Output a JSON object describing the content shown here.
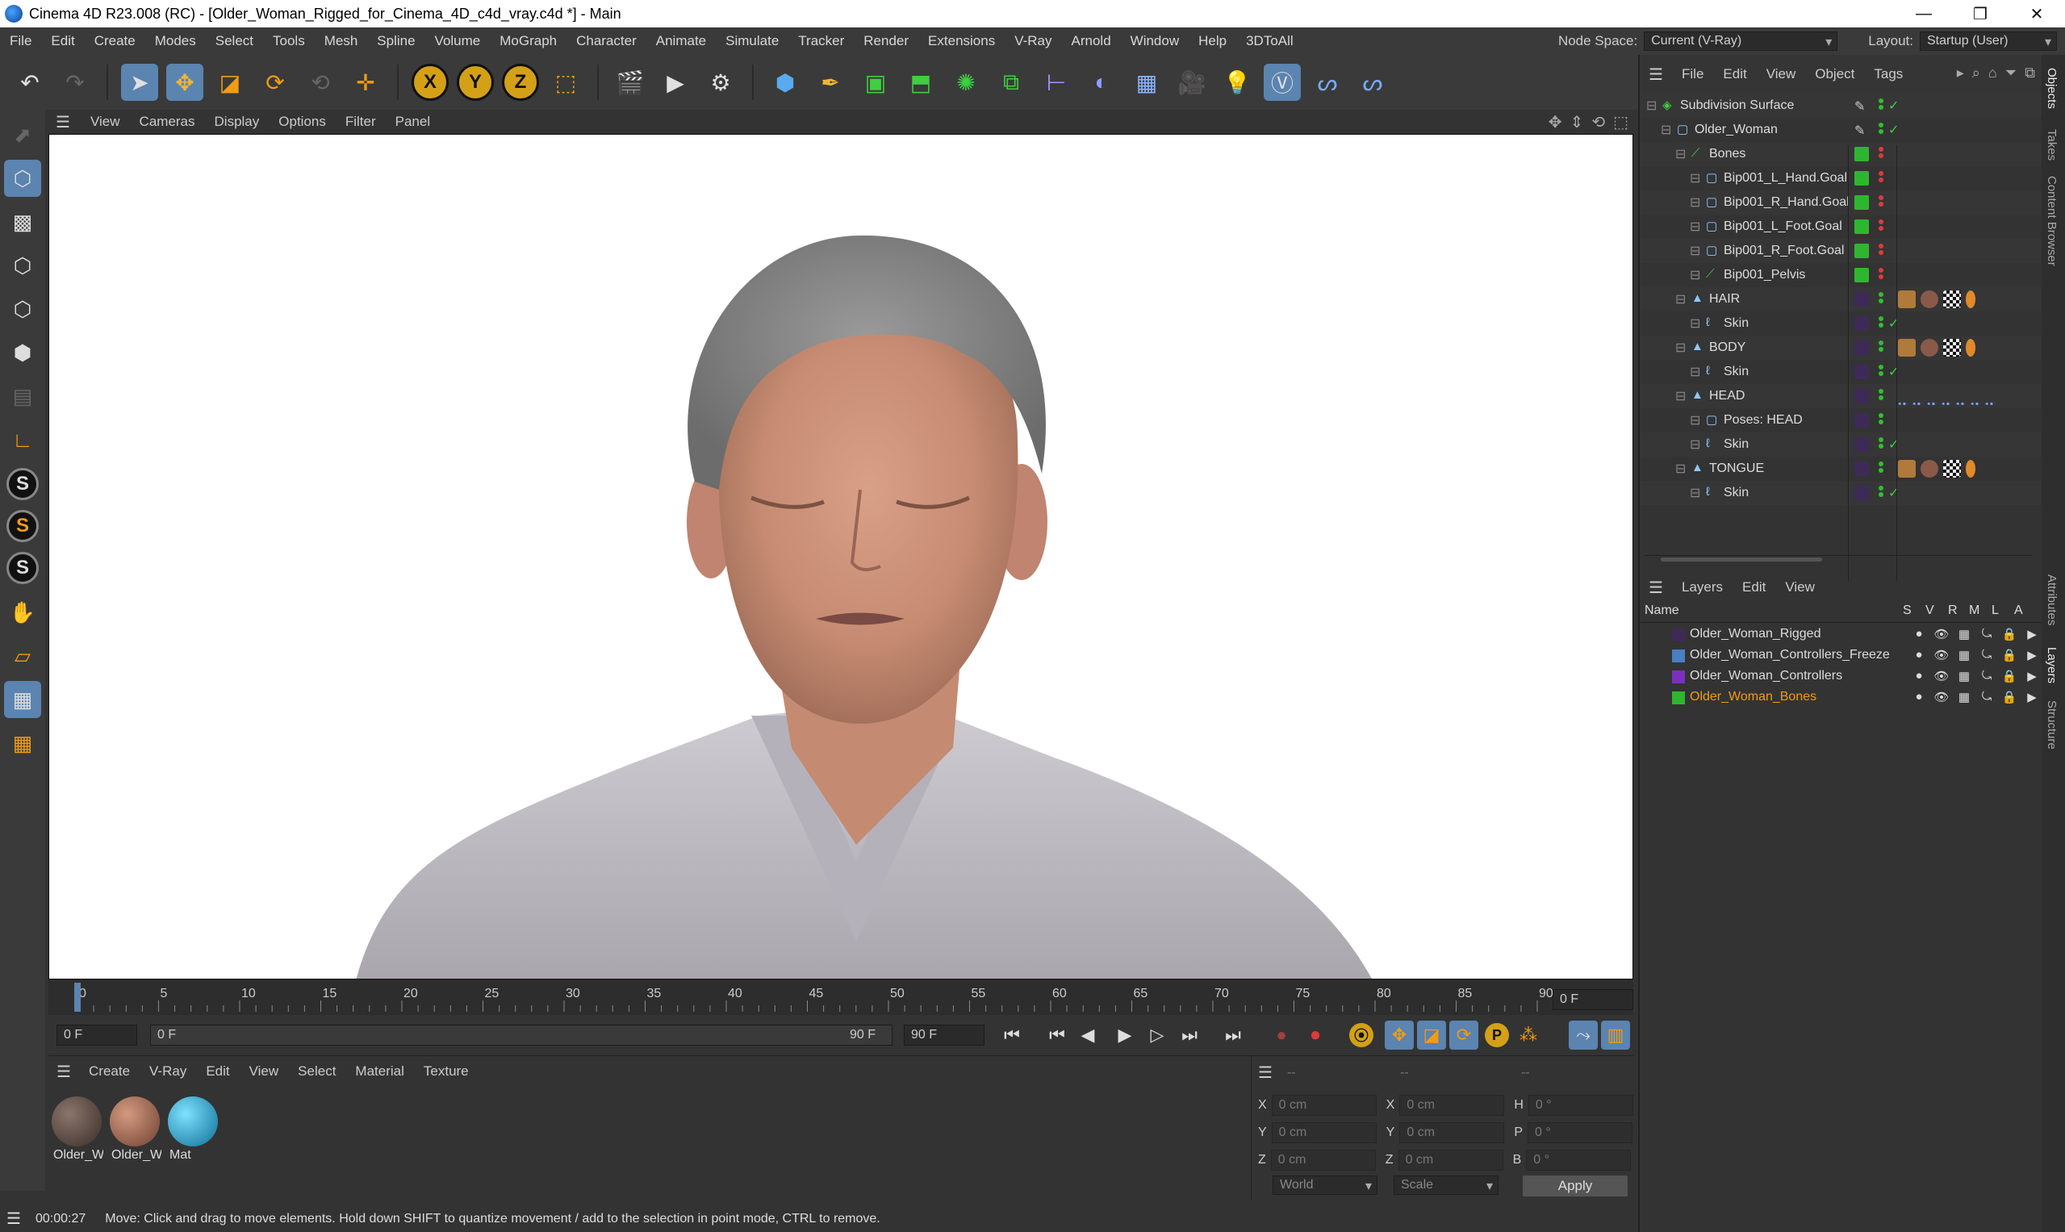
{
  "window": {
    "title": "Cinema 4D R23.008 (RC) - [Older_Woman_Rigged_for_Cinema_4D_c4d_vray.c4d *] - Main",
    "minimize": "—",
    "maximize": "❐",
    "close": "✕"
  },
  "menu": [
    "File",
    "Edit",
    "Create",
    "Modes",
    "Select",
    "Tools",
    "Mesh",
    "Spline",
    "Volume",
    "MoGraph",
    "Character",
    "Animate",
    "Simulate",
    "Tracker",
    "Render",
    "Extensions",
    "V-Ray",
    "Arnold",
    "Window",
    "Help",
    "3DToAll"
  ],
  "menu_right": {
    "node_space_label": "Node Space:",
    "node_space_value": "Current (V-Ray)",
    "layout_label": "Layout:",
    "layout_value": "Startup (User)"
  },
  "viewport_menu": [
    "View",
    "Cameras",
    "Display",
    "Options",
    "Filter",
    "Panel"
  ],
  "timeline": {
    "ticks": [
      "0",
      "5",
      "10",
      "15",
      "20",
      "25",
      "30",
      "35",
      "40",
      "45",
      "50",
      "55",
      "60",
      "65",
      "70",
      "75",
      "80",
      "85",
      "90"
    ],
    "current_frame": "0 F"
  },
  "transport": {
    "start_field": "0 F",
    "range_start": "0 F",
    "range_end": "90 F",
    "end_field": "90 F"
  },
  "material_manager": {
    "menu": [
      "Create",
      "V-Ray",
      "Edit",
      "View",
      "Select",
      "Material",
      "Texture"
    ],
    "materials": [
      {
        "label": "Older_W",
        "color": "#5a4a44"
      },
      {
        "label": "Older_W",
        "color": "#a86e58"
      },
      {
        "label": "Mat",
        "color": "#1ea9d6"
      }
    ]
  },
  "coordinates": {
    "header": [
      "--",
      "--",
      "--"
    ],
    "rows": [
      {
        "a": "X",
        "av": "0 cm",
        "b": "X",
        "bv": "0 cm",
        "c": "H",
        "cv": "0 °"
      },
      {
        "a": "Y",
        "av": "0 cm",
        "b": "Y",
        "bv": "0 cm",
        "c": "P",
        "cv": "0 °"
      },
      {
        "a": "Z",
        "av": "0 cm",
        "b": "Z",
        "bv": "0 cm",
        "c": "B",
        "cv": "0 °"
      }
    ],
    "mode1": "World",
    "mode2": "Scale",
    "apply": "Apply"
  },
  "status": {
    "time": "00:00:27",
    "message": "Move: Click and drag to move elements. Hold down SHIFT to quantize movement / add to the selection in point mode, CTRL to remove."
  },
  "object_manager": {
    "menu": [
      "File",
      "Edit",
      "View",
      "Object",
      "Tags"
    ],
    "objects": [
      {
        "name": "Subdivision Surface",
        "depth": 0,
        "icon": "subdivision-icon",
        "vis": "check"
      },
      {
        "name": "Older_Woman",
        "depth": 1,
        "icon": "null-icon",
        "vis": "check"
      },
      {
        "name": "Bones",
        "depth": 2,
        "icon": "bone-icon",
        "vis": "green"
      },
      {
        "name": "Bip001_L_Hand.Goal",
        "depth": 3,
        "icon": "null-icon",
        "vis": "green"
      },
      {
        "name": "Bip001_R_Hand.Goal",
        "depth": 3,
        "icon": "null-icon",
        "vis": "green"
      },
      {
        "name": "Bip001_L_Foot.Goal",
        "depth": 3,
        "icon": "null-icon",
        "vis": "green"
      },
      {
        "name": "Bip001_R_Foot.Goal",
        "depth": 3,
        "icon": "null-icon",
        "vis": "green"
      },
      {
        "name": "Bip001_Pelvis",
        "depth": 3,
        "icon": "bone-icon",
        "vis": "green"
      },
      {
        "name": "HAIR",
        "depth": 2,
        "icon": "polygon-icon",
        "vis": "purple"
      },
      {
        "name": "Skin",
        "depth": 3,
        "icon": "skin-icon",
        "vis": "purple"
      },
      {
        "name": "BODY",
        "depth": 2,
        "icon": "polygon-icon",
        "vis": "purple"
      },
      {
        "name": "Skin",
        "depth": 3,
        "icon": "skin-icon",
        "vis": "purple"
      },
      {
        "name": "HEAD",
        "depth": 2,
        "icon": "polygon-icon",
        "vis": "purple"
      },
      {
        "name": "Poses: HEAD",
        "depth": 3,
        "icon": "null-icon",
        "vis": "purple"
      },
      {
        "name": "Skin",
        "depth": 3,
        "icon": "skin-icon",
        "vis": "purple"
      },
      {
        "name": "TONGUE",
        "depth": 2,
        "icon": "polygon-icon",
        "vis": "purple"
      },
      {
        "name": "Skin",
        "depth": 3,
        "icon": "skin-icon",
        "vis": "purple"
      }
    ]
  },
  "layers": {
    "menu": [
      "Layers",
      "Edit",
      "View"
    ],
    "columns": [
      "Name",
      "S",
      "V",
      "R",
      "M",
      "L",
      "A"
    ],
    "items": [
      {
        "name": "Older_Woman_Rigged",
        "color": "#3e2a57"
      },
      {
        "name": "Older_Woman_Controllers_Freeze",
        "color": "#4a7fc1"
      },
      {
        "name": "Older_Woman_Controllers",
        "color": "#7b2fbf"
      },
      {
        "name": "Older_Woman_Bones",
        "color": "#2fb62f"
      }
    ]
  },
  "side_tabs": [
    "Objects",
    "Takes",
    "Content Browser",
    "Attributes",
    "Layers",
    "Structure"
  ]
}
